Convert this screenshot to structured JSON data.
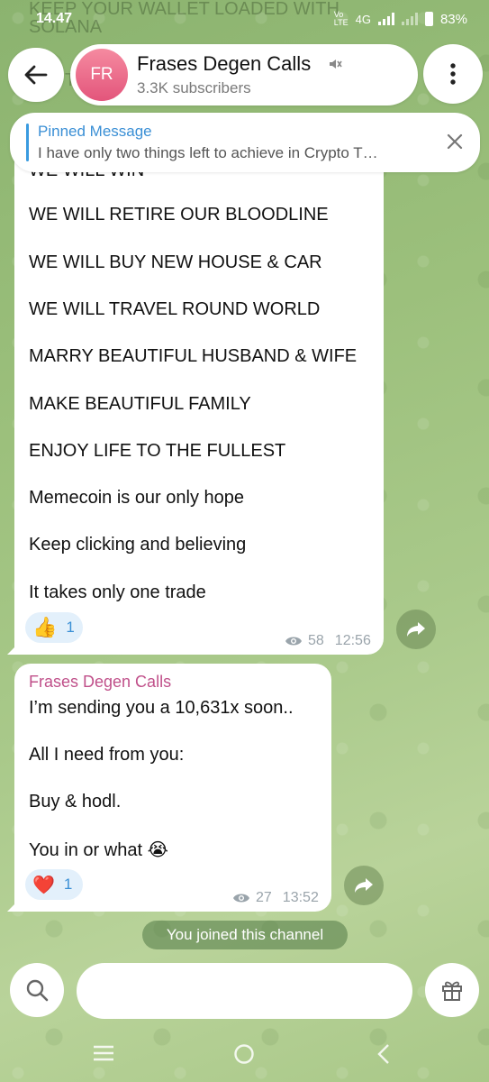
{
  "status_bar": {
    "time": "14.47",
    "network": "4G",
    "battery": "83%"
  },
  "background_text": {
    "top": "KEEP YOUR WALLET LOADED WITH SOLANA",
    "partial": "T"
  },
  "header": {
    "avatar_initials": "FR",
    "title": "Frases Degen Calls",
    "subtitle": "3.3K subscribers"
  },
  "pinned": {
    "title": "Pinned Message",
    "text": "I have only two things left to achieve in Crypto T…"
  },
  "message1": {
    "cutoff_line": "WE WILL WIN",
    "lines": [
      "WE WILL RETIRE OUR BLOODLINE",
      "WE WILL BUY NEW HOUSE & CAR",
      "WE WILL TRAVEL ROUND WORLD",
      "MARRY BEAUTIFUL HUSBAND & WIFE",
      "MAKE BEAUTIFUL FAMILY",
      "ENJOY LIFE TO THE FULLEST",
      "Memecoin is our only hope",
      "Keep clicking and believing",
      "It takes only one trade"
    ],
    "reaction_emoji": "👍",
    "reaction_count": "1",
    "views": "58",
    "time": "12:56"
  },
  "message2": {
    "sender": "Frases Degen Calls",
    "lines": [
      "I’m sending you a 10,631x soon..",
      "All I need from you:",
      "Buy & hodl.",
      "You in or what 😭"
    ],
    "reaction_emoji": "❤️",
    "reaction_count": "1",
    "views": "27",
    "time": "13:52"
  },
  "service_message": "You joined this channel",
  "colors": {
    "accent": "#3a8fd5",
    "sender": "#c0508a",
    "reaction_bg": "#e3f0fb"
  }
}
